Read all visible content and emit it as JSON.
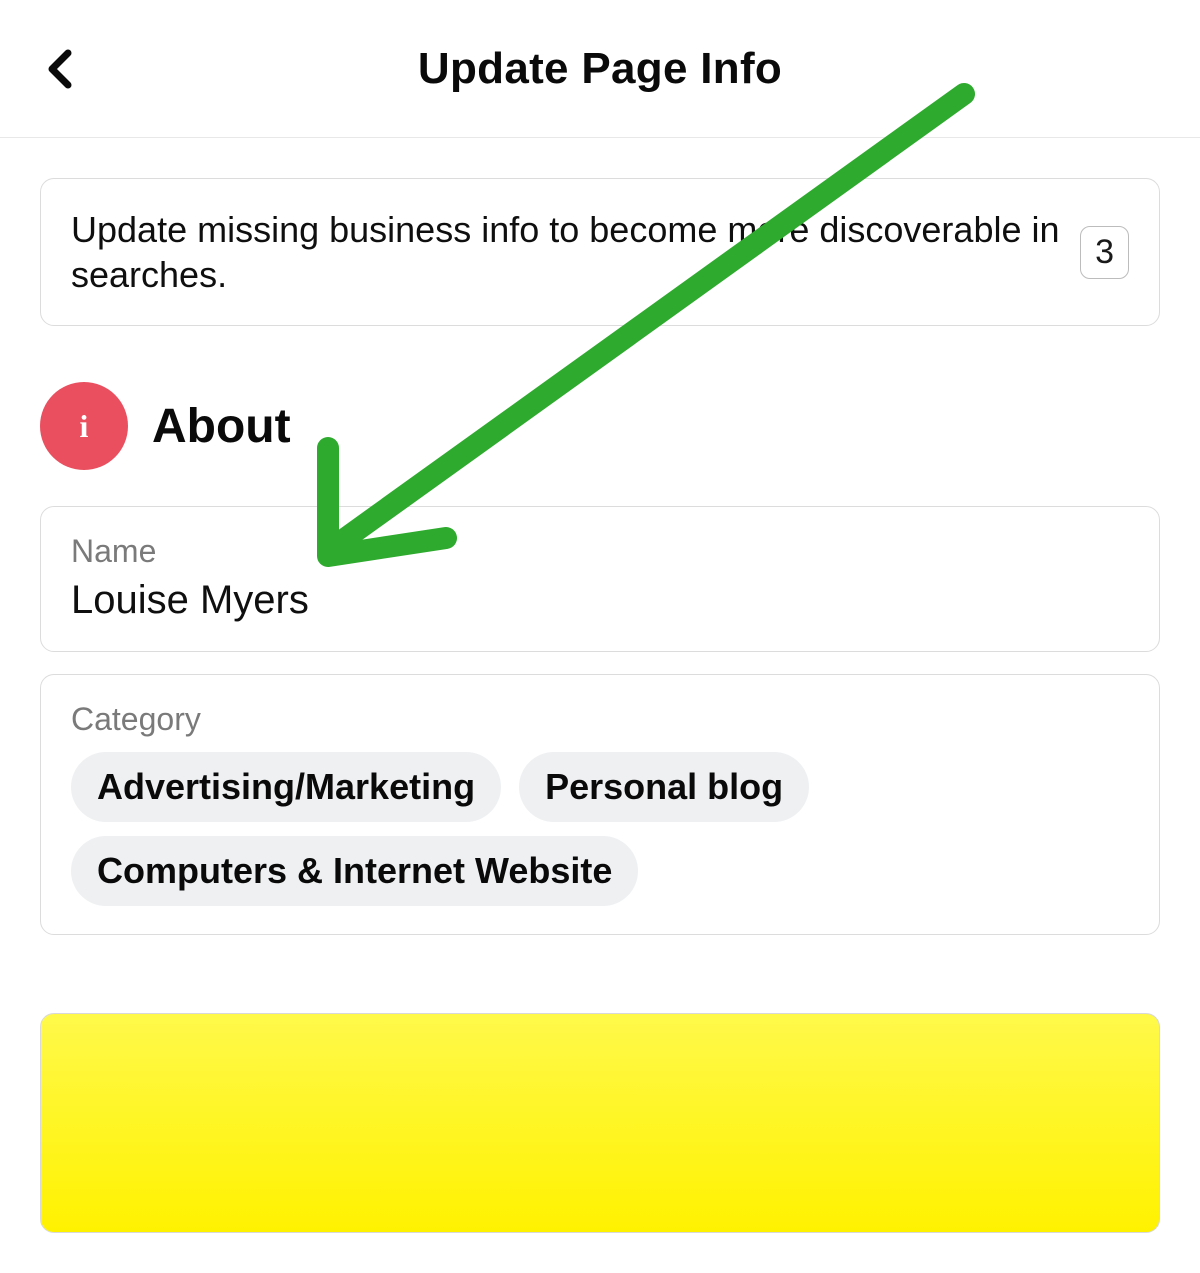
{
  "header": {
    "title": "Update Page Info"
  },
  "banner": {
    "text": "Update missing business info to become more discoverable in searches.",
    "count": "3"
  },
  "about": {
    "section_title": "About",
    "name_label": "Name",
    "name_value": "Louise Myers",
    "category_label": "Category",
    "categories": [
      "Advertising/Marketing",
      "Personal blog",
      "Computers & Internet Website"
    ]
  },
  "colors": {
    "accent": "#e94f5f",
    "arrow": "#2eaa2e"
  }
}
